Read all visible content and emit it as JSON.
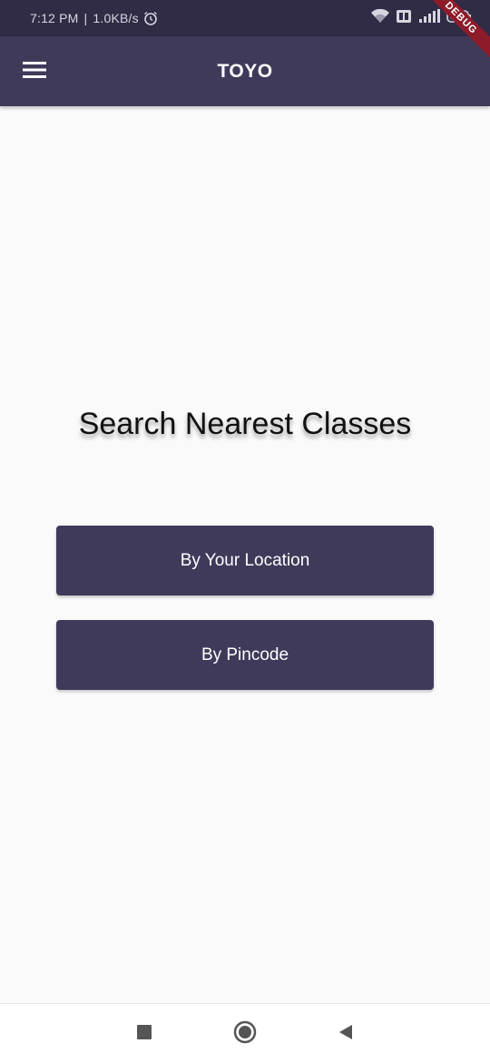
{
  "status_bar": {
    "time": "7:12 PM",
    "separator": "|",
    "network_speed": "1.0KB/s",
    "icons": [
      "alarm-icon",
      "wifi-icon",
      "vo-lte-icon",
      "signal-icon",
      "battery-icon"
    ]
  },
  "debug_banner": "DEBUG",
  "app_bar": {
    "title": "TOYO",
    "menu_icon": "menu-icon",
    "background": "#403a5a"
  },
  "main": {
    "headline": "Search Nearest Classes",
    "buttons": [
      {
        "label": "By Your Location"
      },
      {
        "label": "By Pincode"
      }
    ],
    "button_color": "#403a5a"
  },
  "nav_bar": {
    "icons": [
      "recents-square-icon",
      "home-circle-icon",
      "back-triangle-icon"
    ]
  }
}
